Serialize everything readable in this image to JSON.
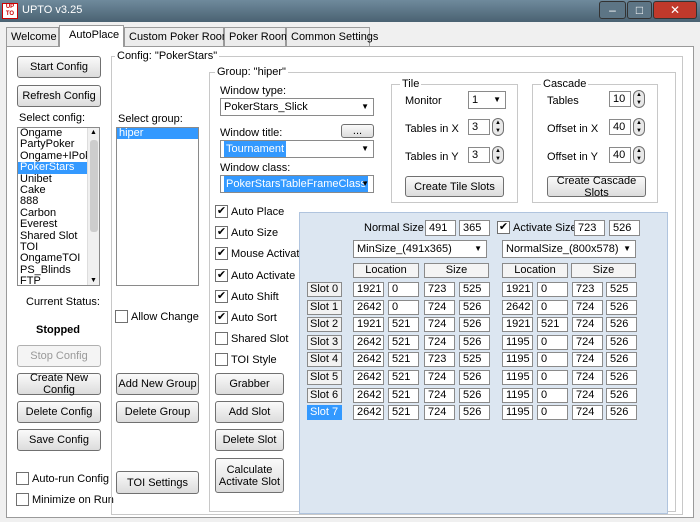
{
  "window": {
    "title": "UPTO  v3.25",
    "logo": "UP TO",
    "min": "–",
    "max": "□",
    "close": "✕"
  },
  "tabs": [
    "Welcome",
    "AutoPlace",
    "Custom Poker Room",
    "Poker Room",
    "Common Settings"
  ],
  "left": {
    "start": "Start Config",
    "refresh": "Refresh Config",
    "select_label": "Select config:",
    "configs": [
      "Ongame",
      "PartyPoker",
      "Ongame+IPoke",
      "PokerStars",
      "Unibet",
      "Cake",
      "888",
      "Carbon",
      "Everest",
      "Shared Slot",
      "TOI",
      "OngameTOI",
      "PS_Blinds",
      "FTP"
    ],
    "selected_index": 3,
    "status_label": "Current Status:",
    "status_value": "Stopped",
    "stop": "Stop Config",
    "create": "Create New Config",
    "delete": "Delete Config",
    "save": "Save Config",
    "autorun": "Auto-run Config",
    "minimize": "Minimize on Run"
  },
  "config": {
    "label": "Config: \"PokerStars\"",
    "select_group": "Select group:",
    "groups": [
      "hiper"
    ],
    "allow_change": "Allow Change",
    "add_group": "Add New Group",
    "delete_group": "Delete Group",
    "toi_settings": "TOI Settings"
  },
  "group": {
    "label": "Group: \"hiper\"",
    "window_type_label": "Window type:",
    "window_type": "PokerStars_Slick",
    "window_title_label": "Window title:",
    "window_title_btn": "...",
    "window_title": "Tournament",
    "window_class_label": "Window class:",
    "window_class": "PokerStarsTableFrameClass",
    "checks": [
      {
        "label": "Auto Place",
        "checked": true
      },
      {
        "label": "Auto Size",
        "checked": true
      },
      {
        "label": "Mouse Activate",
        "checked": true
      },
      {
        "label": "Auto Activate",
        "checked": true
      },
      {
        "label": "Auto Shift",
        "checked": true
      },
      {
        "label": "Auto Sort",
        "checked": true
      },
      {
        "label": "Shared Slot",
        "checked": false
      },
      {
        "label": "TOI Style",
        "checked": false
      }
    ],
    "grabber": "Grabber",
    "add_slot": "Add Slot",
    "delete_slot": "Delete Slot",
    "calc": "Calculate Activate Slot"
  },
  "tile": {
    "title": "Tile",
    "monitor_label": "Monitor",
    "monitor": "1",
    "tx_label": "Tables in X",
    "tx": "3",
    "ty_label": "Tables in Y",
    "ty": "3",
    "create": "Create Tile Slots"
  },
  "cascade": {
    "title": "Cascade",
    "tables_label": "Tables",
    "tables": "10",
    "ox_label": "Offset in X",
    "ox": "40",
    "oy_label": "Offset in Y",
    "oy": "40",
    "create": "Create Cascade Slots"
  },
  "slots": {
    "normal_size_label": "Normal Size",
    "normal_w": "491",
    "normal_h": "365",
    "activate_size_label": "Activate Size",
    "activate_w": "723",
    "activate_h": "526",
    "min_combo": "MinSize_(491x365)",
    "normal_combo": "NormalSize_(800x578)",
    "location_hdr": "Location",
    "size_hdr": "Size",
    "selected_index": 7,
    "rows": [
      {
        "name": "Slot 0",
        "a": [
          "1921",
          "0",
          "723",
          "525"
        ],
        "b": [
          "1921",
          "0",
          "723",
          "525"
        ]
      },
      {
        "name": "Slot 1",
        "a": [
          "2642",
          "0",
          "724",
          "526"
        ],
        "b": [
          "2642",
          "0",
          "724",
          "526"
        ]
      },
      {
        "name": "Slot 2",
        "a": [
          "1921",
          "521",
          "724",
          "526"
        ],
        "b": [
          "1921",
          "521",
          "724",
          "526"
        ]
      },
      {
        "name": "Slot 3",
        "a": [
          "2642",
          "521",
          "724",
          "526"
        ],
        "b": [
          "1195",
          "0",
          "724",
          "526"
        ]
      },
      {
        "name": "Slot 4",
        "a": [
          "2642",
          "521",
          "723",
          "525"
        ],
        "b": [
          "1195",
          "0",
          "724",
          "526"
        ]
      },
      {
        "name": "Slot 5",
        "a": [
          "2642",
          "521",
          "724",
          "526"
        ],
        "b": [
          "1195",
          "0",
          "724",
          "526"
        ]
      },
      {
        "name": "Slot 6",
        "a": [
          "2642",
          "521",
          "724",
          "526"
        ],
        "b": [
          "1195",
          "0",
          "724",
          "526"
        ]
      },
      {
        "name": "Slot 7",
        "a": [
          "2642",
          "521",
          "724",
          "526"
        ],
        "b": [
          "1195",
          "0",
          "724",
          "526"
        ]
      }
    ]
  },
  "colors": {
    "selection": "#3399ff",
    "slot_panel": "#dce6f1",
    "titlebar": "#4a6272",
    "close": "#c0392b"
  }
}
